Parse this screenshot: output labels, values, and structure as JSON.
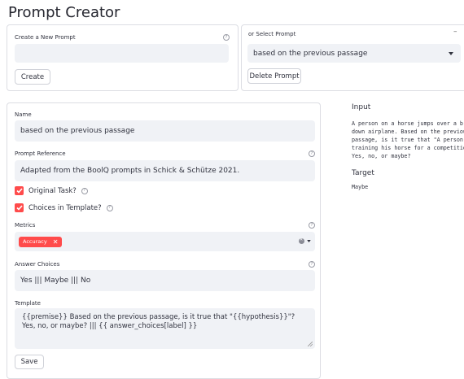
{
  "page": {
    "title": "Prompt Creator"
  },
  "create_panel": {
    "label": "Create a New Prompt",
    "input_value": "",
    "create_button": "Create"
  },
  "select_panel": {
    "label": "or Select Prompt",
    "collapse_glyph": "–",
    "selected": "based on the previous passage",
    "delete_button": "Delete Prompt"
  },
  "form": {
    "name_label": "Name",
    "name_value": "based on the previous passage",
    "reference_label": "Prompt Reference",
    "reference_value": "Adapted from the BoolQ prompts in Schick & Schütze 2021.",
    "original_task_label": "Original Task?",
    "choices_in_template_label": "Choices in Template?",
    "metrics_label": "Metrics",
    "metric_tag": "Accuracy",
    "answer_choices_label": "Answer Choices",
    "answer_choices_value": "Yes ||| Maybe ||| No",
    "template_label": "Template",
    "template_value": "{{premise}} Based on the previous passage, is it true that \"{{hypothesis}}\"? Yes, no, or maybe? ||| {{ answer_choices[label] }}",
    "save_button": "Save"
  },
  "preview": {
    "input_title": "Input",
    "input_lines": [
      "A person on a horse jumps over a brok",
      "down airplane. Based on the previous",
      "passage, is it true that \"A person is",
      "training his horse for a competition.",
      "Yes, no, or maybe?"
    ],
    "target_title": "Target",
    "target_value": "Maybe"
  },
  "colors": {
    "accent": "#ff4b4b",
    "field_bg": "#f0f2f6",
    "border": "#dcdde3"
  }
}
